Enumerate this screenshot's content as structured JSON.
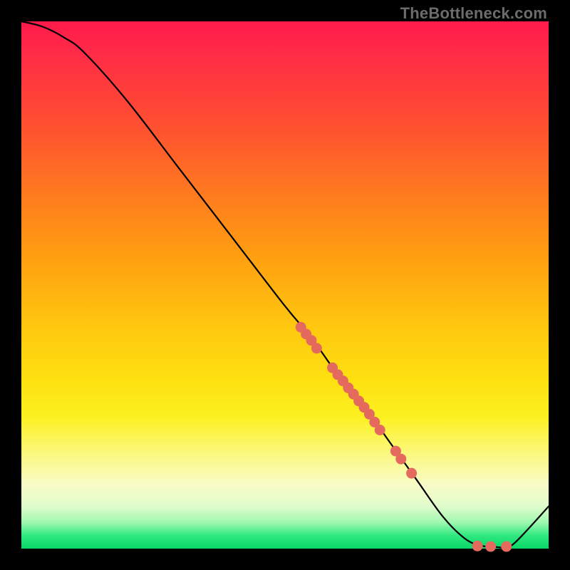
{
  "watermark": "TheBottleneck.com",
  "chart_data": {
    "type": "line",
    "title": "",
    "xlabel": "",
    "ylabel": "",
    "xlim": [
      0,
      100
    ],
    "ylim": [
      0,
      100
    ],
    "grid": false,
    "legend": false,
    "series": [
      {
        "name": "bottleneck-curve",
        "x": [
          0,
          4,
          8,
          12,
          20,
          30,
          40,
          50,
          55,
          60,
          65,
          70,
          75,
          80,
          84,
          87,
          90,
          92,
          94,
          100
        ],
        "y": [
          100,
          99,
          97,
          94,
          85,
          72,
          59,
          46,
          40,
          33,
          27,
          20,
          13,
          6,
          2,
          0.6,
          0.3,
          0.3,
          1.5,
          8
        ]
      }
    ],
    "markers": {
      "name": "sample-points",
      "color": "#e46a5e",
      "x": [
        53,
        54,
        55,
        56,
        59,
        60,
        61,
        62,
        63,
        64,
        65,
        66,
        67,
        68,
        71,
        72,
        74,
        86.5,
        89,
        92
      ],
      "y": [
        42,
        40.7,
        39.5,
        38,
        34.3,
        33,
        31.8,
        30.5,
        29.3,
        28,
        26.8,
        25.5,
        24,
        22.5,
        18.5,
        17,
        14.3,
        0.5,
        0.4,
        0.4
      ]
    }
  }
}
